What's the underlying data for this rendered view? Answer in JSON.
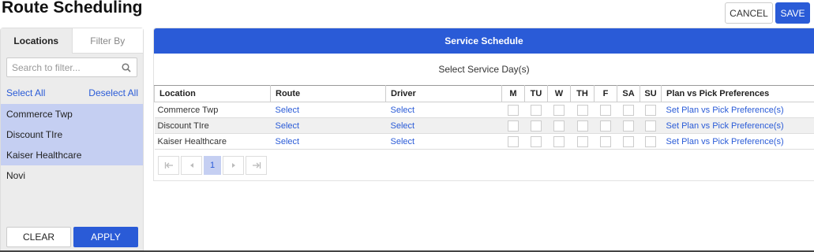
{
  "header": {
    "title": "Route Scheduling",
    "cancel_label": "CANCEL",
    "save_label": "SAVE"
  },
  "left": {
    "tabs": [
      {
        "label": "Locations"
      },
      {
        "label": "Filter By"
      }
    ],
    "search_placeholder": "Search to filter...",
    "select_all": "Select All",
    "deselect_all": "Deselect All",
    "items": [
      {
        "label": "Commerce Twp",
        "selected": true
      },
      {
        "label": "Discount TIre",
        "selected": true
      },
      {
        "label": "Kaiser Healthcare",
        "selected": true
      },
      {
        "label": "Novi",
        "selected": false
      }
    ],
    "clear_label": "CLEAR",
    "apply_label": "APPLY"
  },
  "schedule": {
    "title": "Service Schedule",
    "subtitle": "Select Service Day(s)",
    "columns": [
      "Location",
      "Route",
      "Driver",
      "M",
      "TU",
      "W",
      "TH",
      "F",
      "SA",
      "SU",
      "Plan vs Pick Preferences"
    ],
    "rows": [
      {
        "location": "Commerce Twp",
        "route": "Select",
        "driver": "Select",
        "pref": "Set Plan vs Pick Preference(s)"
      },
      {
        "location": "Discount TIre",
        "route": "Select",
        "driver": "Select",
        "pref": "Set Plan vs Pick Preference(s)"
      },
      {
        "location": "Kaiser Healthcare",
        "route": "Select",
        "driver": "Select",
        "pref": "Set Plan vs Pick Preference(s)"
      }
    ],
    "pager": {
      "current_page": "1"
    }
  },
  "colors": {
    "accent": "#2a5bd7",
    "selected_bg": "#c5cff2"
  },
  "icons": [
    "search-icon",
    "first-page-icon",
    "prev-page-icon",
    "next-page-icon",
    "last-page-icon"
  ]
}
